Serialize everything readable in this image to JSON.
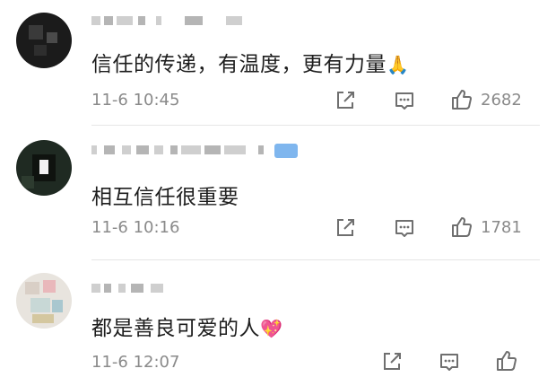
{
  "comments": [
    {
      "text": "信任的传递，有温度，更有力量",
      "emoji": "🙏",
      "time": "11-6 10:45",
      "like_count": "2682"
    },
    {
      "text": "相互信任很重要",
      "emoji": "",
      "time": "11-6 10:16",
      "like_count": "1781"
    },
    {
      "text": "都是善良可爱的人",
      "emoji": "💖",
      "time": "11-6 12:07",
      "like_count": ""
    }
  ],
  "icons": {
    "share": "share-icon",
    "comment": "comment-icon",
    "like": "thumbs-up-icon"
  },
  "colors": {
    "meta_text": "#8a8a8a",
    "icon_stroke": "#6f6f6f",
    "badge_blue": "#7fb6ee"
  }
}
